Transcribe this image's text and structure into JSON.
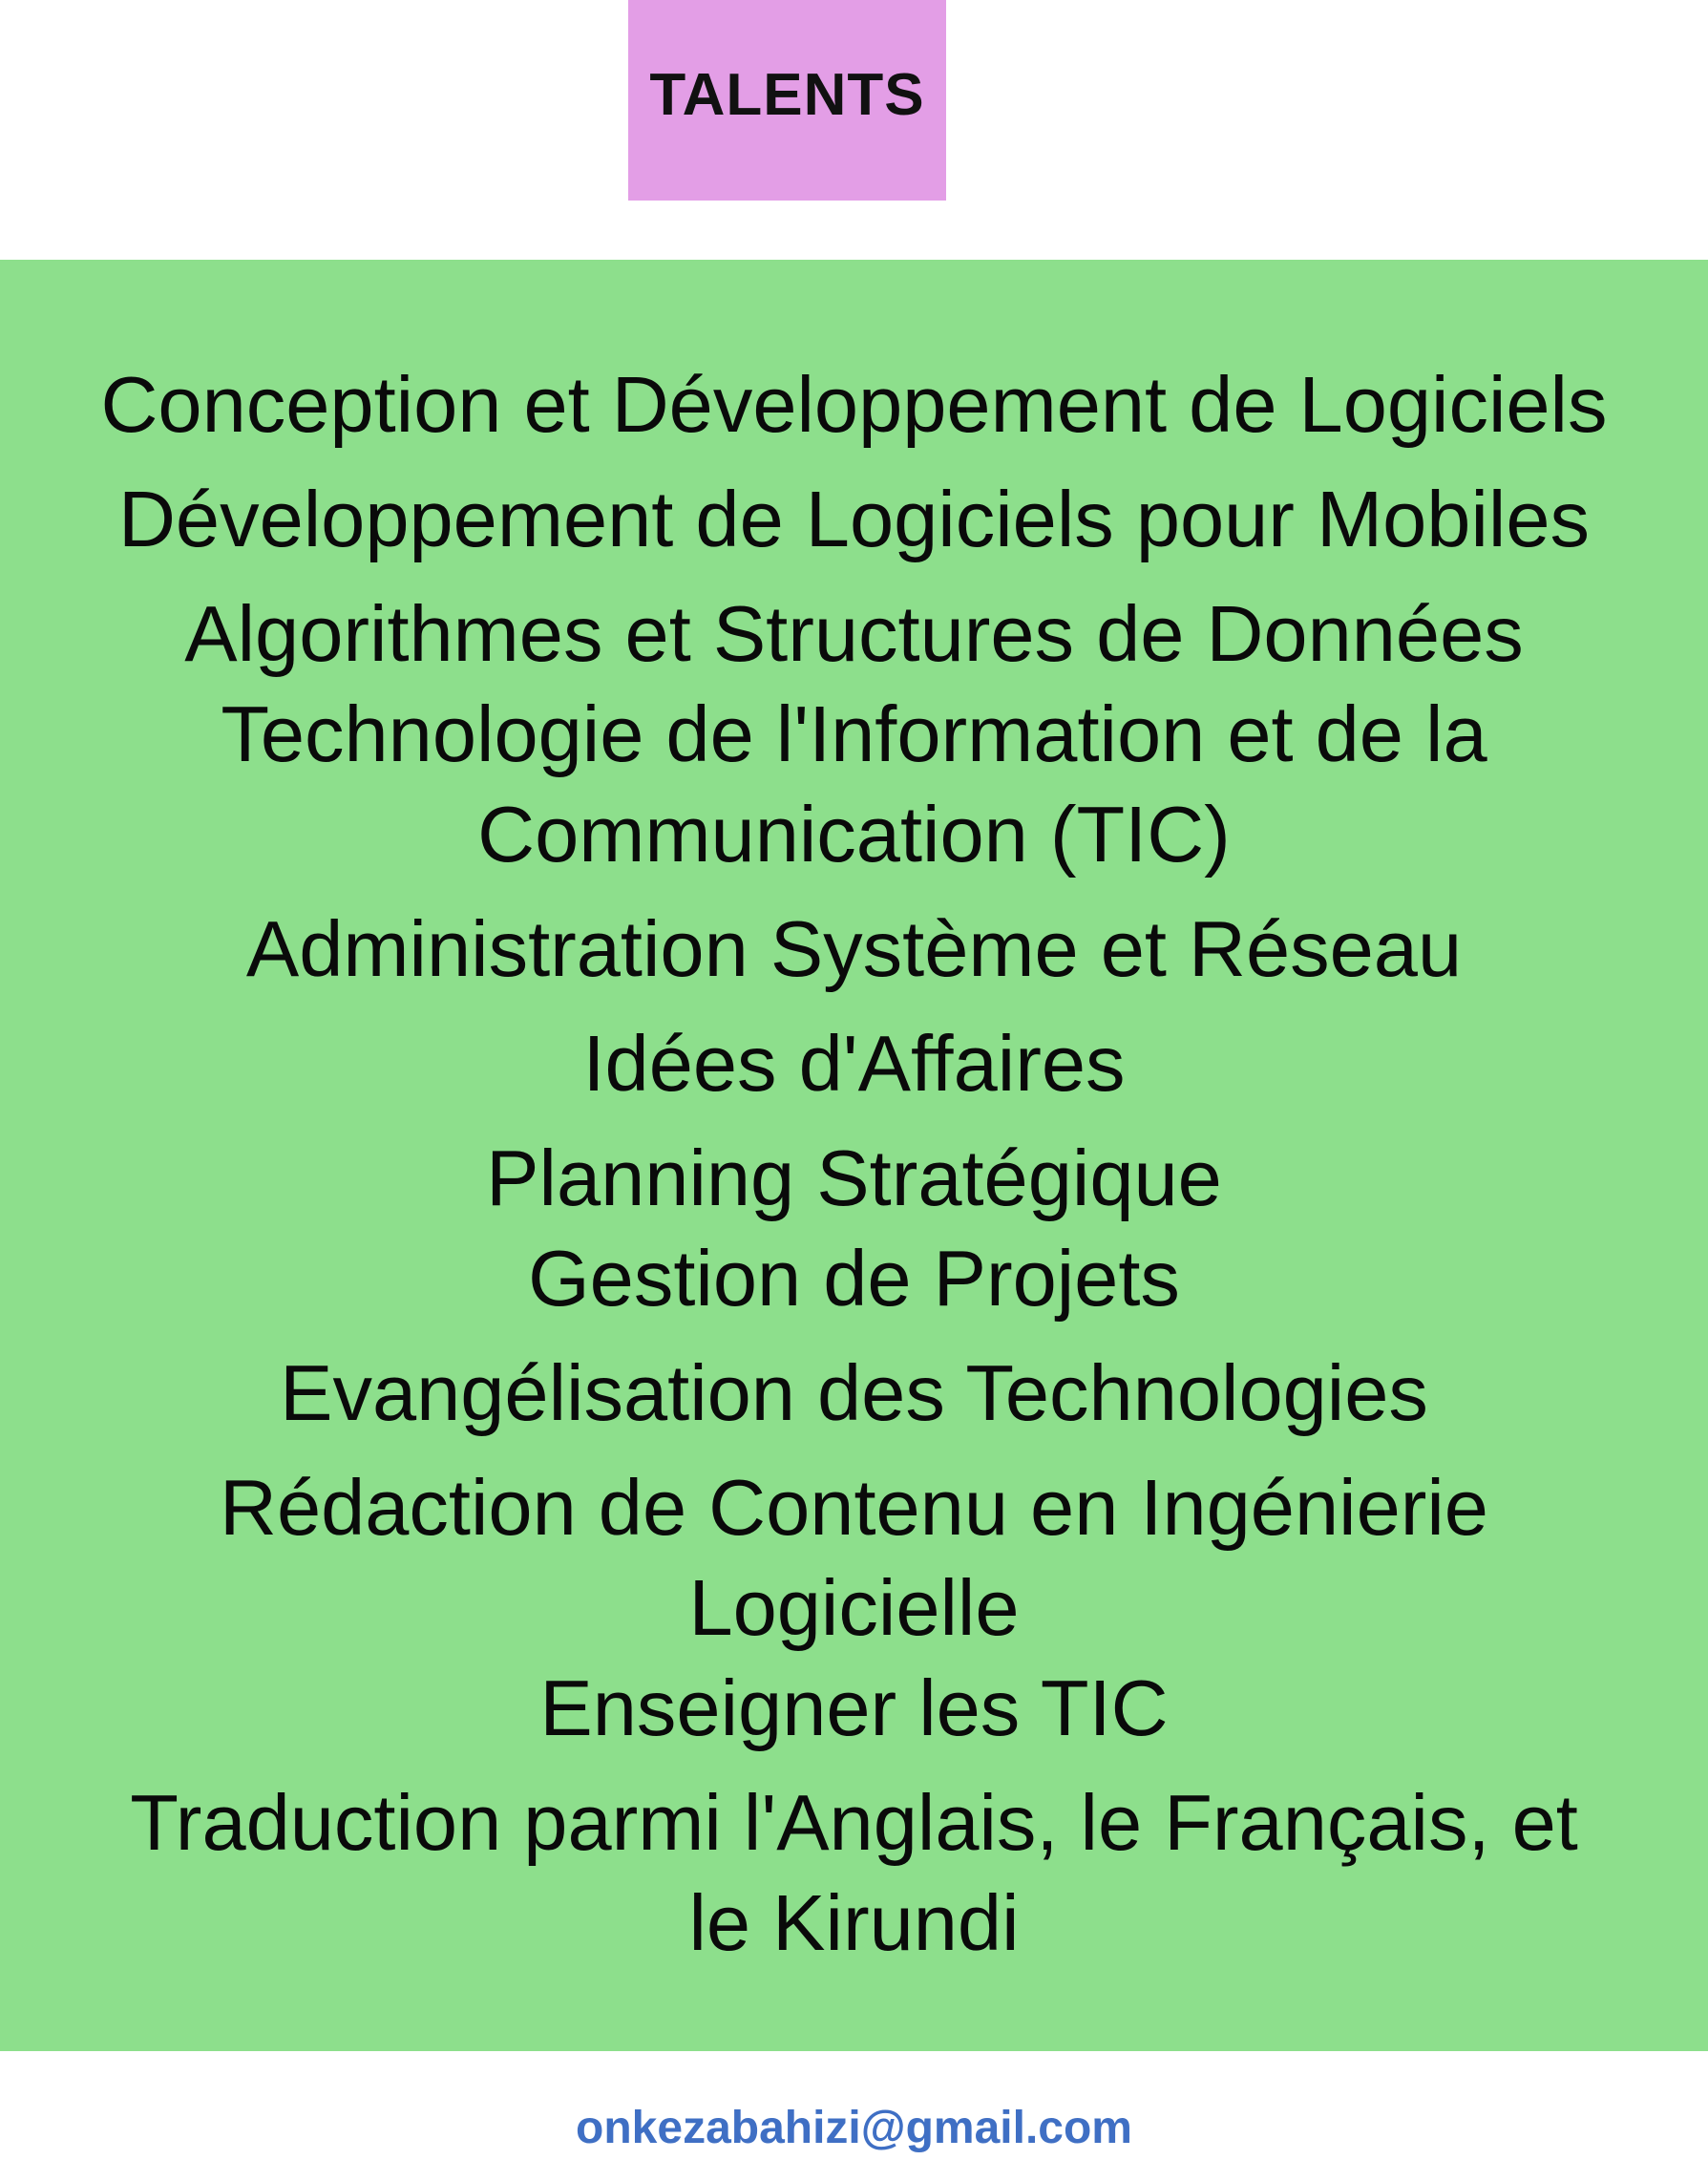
{
  "header": {
    "title": "TALENTS",
    "title_bg_color": "#e39ee6"
  },
  "panel": {
    "bg_color": "#8ddf8c",
    "lines": [
      "Conception et Développement de Logiciels",
      "Développement de Logiciels pour Mobiles",
      "Algorithmes et Structures de Données",
      "Technologie de l'Information et de la",
      "Communication (TIC)",
      "Administration Système et Réseau",
      "Idées d'Affaires",
      "Planning Stratégique",
      "Gestion de Projets",
      "Evangélisation des Technologies",
      "Rédaction de Contenu en Ingénierie",
      "Logicielle",
      "Enseigner les TIC",
      "Traduction parmi l'Anglais, le Français, et",
      "le Kirundi"
    ]
  },
  "footer": {
    "email": "onkezabahizi@gmail.com",
    "email_color": "#3f6fc4"
  }
}
